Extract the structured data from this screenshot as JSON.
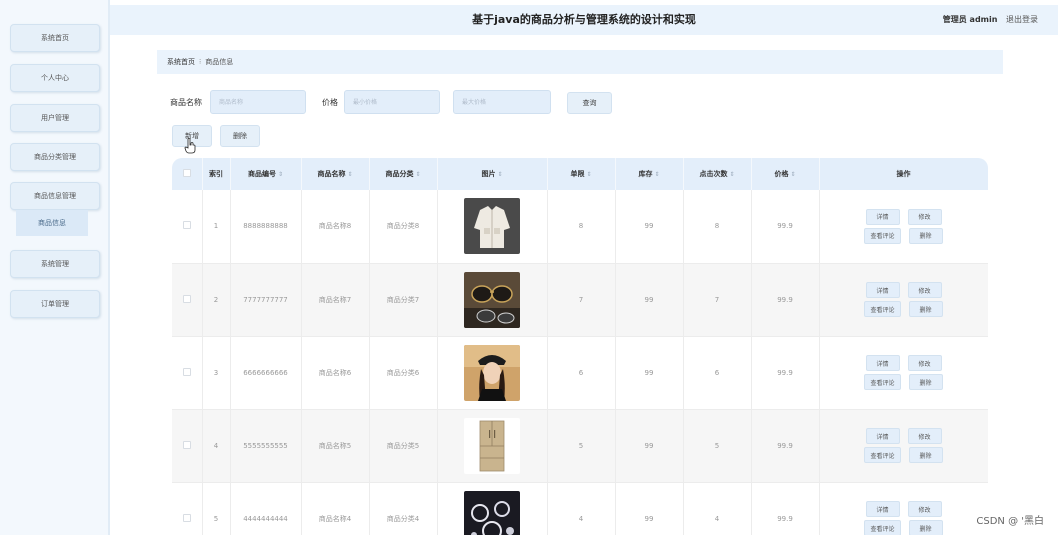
{
  "header": {
    "title": "基于java的商品分析与管理系统的设计和实现",
    "admin_label": "管理员 admin",
    "logout_label": "退出登录"
  },
  "sidebar": {
    "items": [
      {
        "label": "系统首页"
      },
      {
        "label": "个人中心"
      },
      {
        "label": "用户管理"
      },
      {
        "label": "商品分类管理"
      },
      {
        "label": "商品信息管理"
      },
      {
        "label": "系统管理"
      },
      {
        "label": "订单管理"
      }
    ],
    "sub_item": "商品信息"
  },
  "breadcrumb": {
    "home": "系统首页",
    "separator": "⁝",
    "current": "商品信息"
  },
  "search": {
    "name_label": "商品名称",
    "name_placeholder": "商品名称",
    "price_label": "价格",
    "min_placeholder": "最小价格",
    "max_placeholder": "最大价格",
    "query_label": "查询"
  },
  "actions": {
    "add_label": "新增",
    "delete_label": "删除"
  },
  "table": {
    "headers": {
      "index": "索引",
      "code": "商品编号",
      "name": "商品名称",
      "category": "商品分类",
      "image": "图片",
      "limit": "单限",
      "stock": "库存",
      "clicks": "点击次数",
      "price": "价格",
      "ops": "操作"
    },
    "sort_glyph": "⇕",
    "rows": [
      {
        "index": "1",
        "code": "8888888888",
        "name": "商品名称8",
        "category": "商品分类8",
        "limit": "8",
        "stock": "99",
        "clicks": "8",
        "price": "99.9",
        "image": "jacket"
      },
      {
        "index": "2",
        "code": "7777777777",
        "name": "商品名称7",
        "category": "商品分类7",
        "limit": "7",
        "stock": "99",
        "clicks": "7",
        "price": "99.9",
        "image": "sunglasses"
      },
      {
        "index": "3",
        "code": "6666666666",
        "name": "商品名称6",
        "category": "商品分类6",
        "limit": "6",
        "stock": "99",
        "clicks": "6",
        "price": "99.9",
        "image": "woman-with-hat"
      },
      {
        "index": "4",
        "code": "5555555555",
        "name": "商品名称5",
        "category": "商品分类5",
        "limit": "5",
        "stock": "99",
        "clicks": "5",
        "price": "99.9",
        "image": "refrigerator"
      },
      {
        "index": "5",
        "code": "4444444444",
        "name": "商品名称4",
        "category": "商品分类4",
        "limit": "4",
        "stock": "99",
        "clicks": "4",
        "price": "99.9",
        "image": "jewelry"
      }
    ],
    "op_labels": {
      "detail": "详情",
      "edit": "修改",
      "review": "查看评论",
      "delete": "删除"
    }
  },
  "watermark": "CSDN @ '黑白",
  "colors": {
    "accent_bg": "#e3eefa",
    "sidebar_bg": "#f3f8fd",
    "header_bg": "#eaf3fc"
  }
}
